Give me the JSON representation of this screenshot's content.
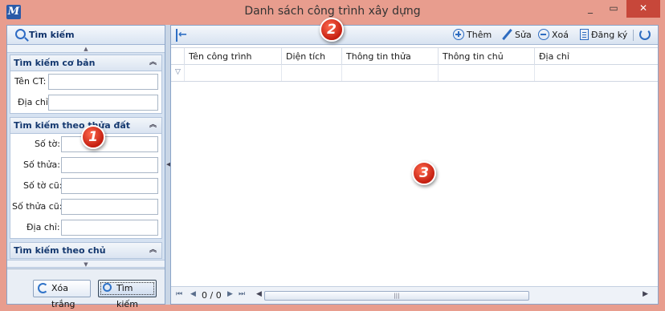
{
  "window": {
    "title": "Danh sách công trình xây dựng",
    "app_icon_glyph": "M",
    "minimize_glyph": "_",
    "maximize_glyph": "▭",
    "close_glyph": "✕"
  },
  "left_panel": {
    "header": "Tìm kiếm",
    "groups": [
      {
        "title": "Tìm kiếm cơ bản",
        "fields": [
          {
            "label": "Tên CT:",
            "value": ""
          },
          {
            "label": "Địa chỉ:",
            "value": ""
          }
        ]
      },
      {
        "title": "Tìm kiếm theo thửa đất",
        "fields": [
          {
            "label": "Số tờ:",
            "value": ""
          },
          {
            "label": "Số thửa:",
            "value": ""
          },
          {
            "label": "Số tờ cũ:",
            "value": ""
          },
          {
            "label": "Số thửa cũ:",
            "value": ""
          },
          {
            "label": "Địa chỉ:",
            "value": ""
          }
        ]
      },
      {
        "title": "Tìm kiếm theo chủ"
      }
    ],
    "buttons": {
      "clear": "Xóa trắng",
      "search": "Tìm kiếm"
    }
  },
  "toolbar": {
    "add": "Thêm",
    "edit": "Sửa",
    "delete": "Xoá",
    "register": "Đăng ký"
  },
  "grid": {
    "columns": [
      "Tên công trình",
      "Diện tích",
      "Thông tin thửa",
      "Thông tin chủ",
      "Địa chỉ"
    ],
    "rows": []
  },
  "pager": {
    "page_text": "0 / 0"
  },
  "markers": [
    "1",
    "2",
    "3"
  ]
}
